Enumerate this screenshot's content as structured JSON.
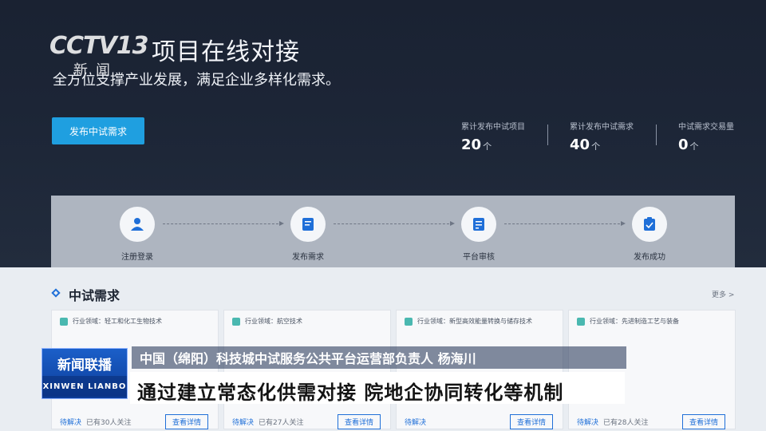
{
  "overlay": {
    "logo_main": "CCTV13",
    "logo_news": "新闻",
    "program_cn": "新闻联播",
    "program_en": "XINWEN LIANBO",
    "caption_speaker": "中国（绵阳）科技城中试服务公共平台运营部负责人 杨海川",
    "caption_main": "通过建立常态化供需对接 院地企协同转化等机制"
  },
  "hero": {
    "title": "项目在线对接",
    "subtitle": "全方位支撑产业发展，满足企业多样化需求。",
    "publish_button": "发布中试需求"
  },
  "stats": [
    {
      "label": "累计发布中试项目",
      "value": "20",
      "unit": "个"
    },
    {
      "label": "累计发布中试需求",
      "value": "40",
      "unit": "个"
    },
    {
      "label": "中试需求交易量",
      "value": "0",
      "unit": "个"
    }
  ],
  "steps": [
    {
      "label": "注册登录",
      "icon": "user-icon"
    },
    {
      "label": "发布需求",
      "icon": "edit-document-icon"
    },
    {
      "label": "平台审核",
      "icon": "review-icon"
    },
    {
      "label": "发布成功",
      "icon": "clipboard-check-icon"
    }
  ],
  "section": {
    "title": "中试需求",
    "more": "更多 >"
  },
  "cards": [
    {
      "tag": "行业领域：轻工和化工生物技术",
      "status": "待解决",
      "follow": "已有30人关注",
      "button": "查看详情"
    },
    {
      "tag": "行业领域：航空技术",
      "status": "待解决",
      "follow": "已有27人关注",
      "button": "查看详情"
    },
    {
      "tag": "行业领域：新型高效能量转换与储存技术",
      "status": "待解决",
      "follow": "",
      "button": "查看详情"
    },
    {
      "tag": "行业领域：先进制造工艺与装备",
      "status": "待解决",
      "follow": "已有28人关注",
      "button": "查看详情"
    }
  ],
  "colors": {
    "accent": "#1f9fe0",
    "link": "#1f6fd8",
    "hero_bg": "#1c2536",
    "steps_bg": "#aeb5c0"
  }
}
